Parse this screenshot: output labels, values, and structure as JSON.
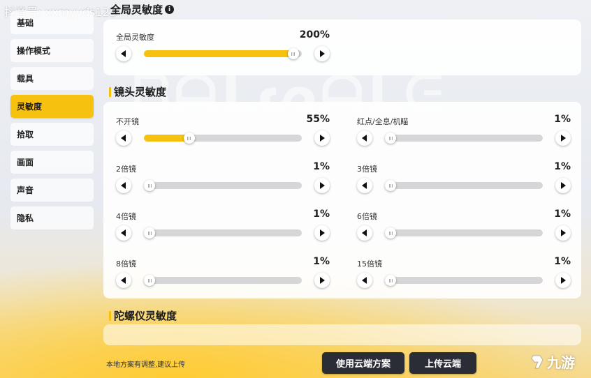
{
  "watermark": "抖音号: xxmyyds125",
  "sidebar": {
    "items": [
      {
        "label": "基础",
        "active": false
      },
      {
        "label": "操作模式",
        "active": false
      },
      {
        "label": "载具",
        "active": false
      },
      {
        "label": "灵敏度",
        "active": true
      },
      {
        "label": "拾取",
        "active": false
      },
      {
        "label": "画面",
        "active": false
      },
      {
        "label": "声音",
        "active": false
      },
      {
        "label": "隐私",
        "active": false
      }
    ]
  },
  "global_section": {
    "title": "全局灵敏度",
    "slider": {
      "label": "全局灵敏度",
      "value_text": "200%",
      "fraction": 0.98
    }
  },
  "scope_section": {
    "title": "镜头灵敏度",
    "sliders": [
      {
        "label": "不开镜",
        "value_text": "55%",
        "fraction": 0.27
      },
      {
        "label": "红点/全息/机瞄",
        "value_text": "1%",
        "fraction": 0.0
      },
      {
        "label": "2倍镜",
        "value_text": "1%",
        "fraction": 0.0
      },
      {
        "label": "3倍镜",
        "value_text": "1%",
        "fraction": 0.0
      },
      {
        "label": "4倍镜",
        "value_text": "1%",
        "fraction": 0.0
      },
      {
        "label": "6倍镜",
        "value_text": "1%",
        "fraction": 0.0
      },
      {
        "label": "8倍镜",
        "value_text": "1%",
        "fraction": 0.0
      },
      {
        "label": "15倍镜",
        "value_text": "1%",
        "fraction": 0.0
      }
    ]
  },
  "gyro_section": {
    "title": "陀螺仪灵敏度"
  },
  "footer": {
    "note": "本地方案有调整,建议上传",
    "use_cloud_label": "使用云端方案",
    "upload_label": "上传云端"
  },
  "logo_text": "九游",
  "colors": {
    "accent": "#f7c20f",
    "button_dark": "#2a2d36",
    "track": "#d6d6d8"
  }
}
